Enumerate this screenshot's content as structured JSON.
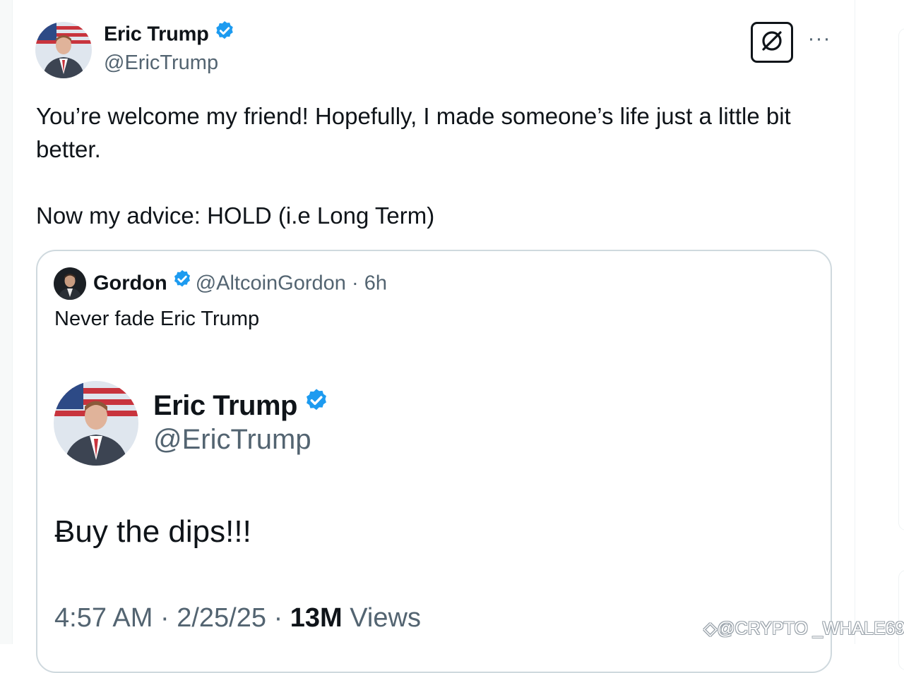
{
  "tweet": {
    "author_name": "Eric Trump",
    "author_handle": "@EricTrump",
    "body_line1": "You’re welcome my friend! Hopefully, I made someone’s life just a little bit better.",
    "body_line2": "Now my advice: HOLD (i.e Long Term)"
  },
  "header_actions": {
    "grok_icon": "grok-icon",
    "more_label": "···"
  },
  "quote": {
    "author_name": "Gordon",
    "author_handle": "@AltcoinGordon",
    "separator": "·",
    "time": "6h",
    "text": "Never fade Eric Trump"
  },
  "embedded": {
    "author_name": "Eric Trump",
    "author_handle": "@EricTrump",
    "text": "Ƀuy the dips!!!",
    "time": "4:57 AM",
    "date": "2/25/25",
    "views_count": "13M",
    "views_label": "Views",
    "separator": "·"
  },
  "watermark": "@CRYPTO _WHALE69",
  "colors": {
    "verified_blue": "#1d9bf0",
    "text_primary": "#0f1419",
    "text_secondary": "#536471",
    "border": "#cfd9de"
  }
}
